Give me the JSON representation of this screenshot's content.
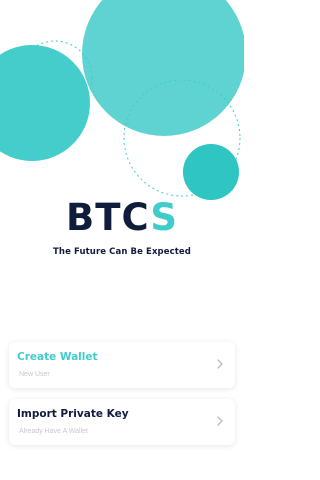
{
  "brand": {
    "logo_part1": "B",
    "logo_part2": "T",
    "logo_part3": "C",
    "logo_part4": "S",
    "slogan": "The Future Can Be Expected"
  },
  "actions": [
    {
      "title": "Create Wallet",
      "subtitle": "New User",
      "icon": "chevron-right-icon"
    },
    {
      "title": "Import Private Key",
      "subtitle": "Already Have A Wallet",
      "icon": "chevron-right-icon"
    }
  ],
  "colors": {
    "accent": "#3fcccb",
    "dark": "#0f1c3c",
    "muted": "#c4c8cf"
  }
}
